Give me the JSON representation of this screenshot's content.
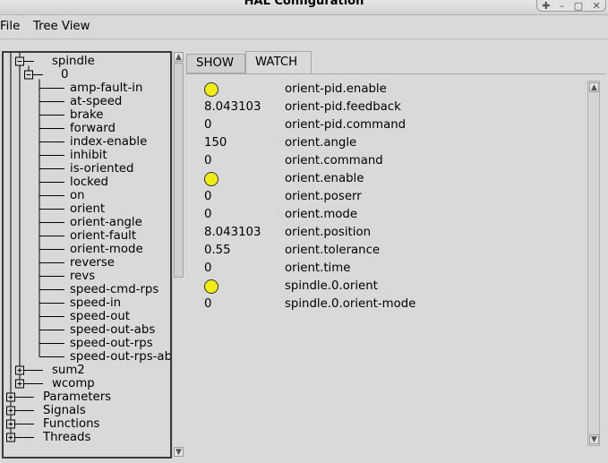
{
  "window": {
    "title": "HAL Configuration",
    "controls": [
      "minimize-icon",
      "restore-icon",
      "maximize-icon",
      "close-icon"
    ]
  },
  "menubar": {
    "items": [
      "File",
      "Tree View"
    ]
  },
  "tree": {
    "spindle_label": "spindle",
    "zero_label": "0",
    "pins": [
      "amp-fault-in",
      "at-speed",
      "brake",
      "forward",
      "index-enable",
      "inhibit",
      "is-oriented",
      "locked",
      "on",
      "orient",
      "orient-angle",
      "orient-fault",
      "orient-mode",
      "reverse",
      "revs",
      "speed-cmd-rps",
      "speed-in",
      "speed-out",
      "speed-out-abs",
      "speed-out-rps",
      "speed-out-rps-abs"
    ],
    "siblings": [
      "sum2",
      "wcomp"
    ],
    "top_level": [
      "Parameters",
      "Signals",
      "Functions",
      "Threads"
    ]
  },
  "tabs": {
    "show": "SHOW",
    "watch": "WATCH",
    "active": "WATCH"
  },
  "watch": [
    {
      "kind": "bit",
      "value": true,
      "name": "orient-pid.enable"
    },
    {
      "kind": "num",
      "value": "8.043103",
      "name": "orient-pid.feedback"
    },
    {
      "kind": "num",
      "value": "0",
      "name": "orient-pid.command"
    },
    {
      "kind": "num",
      "value": "150",
      "name": "orient.angle"
    },
    {
      "kind": "num",
      "value": "0",
      "name": "orient.command"
    },
    {
      "kind": "bit",
      "value": true,
      "name": "orient.enable"
    },
    {
      "kind": "num",
      "value": "0",
      "name": "orient.poserr"
    },
    {
      "kind": "num",
      "value": "0",
      "name": "orient.mode"
    },
    {
      "kind": "num",
      "value": "8.043103",
      "name": "orient.position"
    },
    {
      "kind": "num",
      "value": "0.55",
      "name": "orient.tolerance"
    },
    {
      "kind": "num",
      "value": "0",
      "name": "orient.time"
    },
    {
      "kind": "bit",
      "value": true,
      "name": "spindle.0.orient"
    },
    {
      "kind": "num",
      "value": "0",
      "name": "spindle.0.orient-mode"
    }
  ],
  "colors": {
    "led_on": "#f2ec14",
    "background": "#d9d9d9"
  }
}
